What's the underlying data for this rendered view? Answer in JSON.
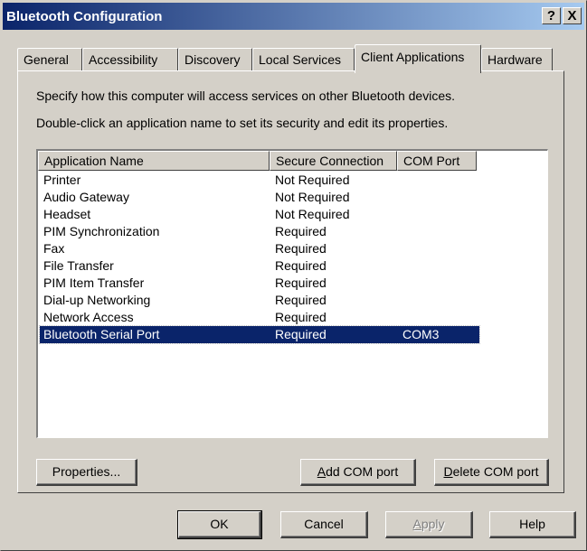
{
  "window": {
    "title": "Bluetooth Configuration",
    "help_btn": "?",
    "close_btn": "X"
  },
  "tabs": [
    {
      "label": "General"
    },
    {
      "label": "Accessibility"
    },
    {
      "label": "Discovery"
    },
    {
      "label": "Local Services"
    },
    {
      "label": "Client Applications",
      "active": true
    },
    {
      "label": "Hardware"
    }
  ],
  "panel": {
    "desc1": "Specify how this computer will access services on other Bluetooth devices.",
    "desc2": "Double-click an application name to set its security and edit its properties."
  },
  "table": {
    "columns": [
      "Application Name",
      "Secure Connection",
      "COM Port"
    ],
    "rows": [
      [
        "Printer",
        "Not Required",
        ""
      ],
      [
        "Audio Gateway",
        "Not Required",
        ""
      ],
      [
        "Headset",
        "Not Required",
        ""
      ],
      [
        "PIM Synchronization",
        "Required",
        ""
      ],
      [
        "Fax",
        "Required",
        ""
      ],
      [
        "File Transfer",
        "Required",
        ""
      ],
      [
        "PIM Item Transfer",
        "Required",
        ""
      ],
      [
        "Dial-up Networking",
        "Required",
        ""
      ],
      [
        "Network Access",
        "Required",
        ""
      ],
      [
        "Bluetooth Serial Port",
        "Required",
        "COM3"
      ]
    ],
    "selected_row": 9
  },
  "panel_buttons": {
    "properties": "Properties...",
    "add_com_a": "A",
    "add_com_rest": "dd COM port",
    "delete_com_a": "D",
    "delete_com_rest": "elete COM port"
  },
  "dialog_buttons": {
    "ok": "OK",
    "cancel": "Cancel",
    "apply_a": "A",
    "apply_rest": "pply",
    "help": "Help"
  },
  "colors": {
    "title_start": "#0a246a",
    "title_end": "#a6caf0",
    "selection": "#0a246a",
    "face": "#d4d0c8"
  }
}
